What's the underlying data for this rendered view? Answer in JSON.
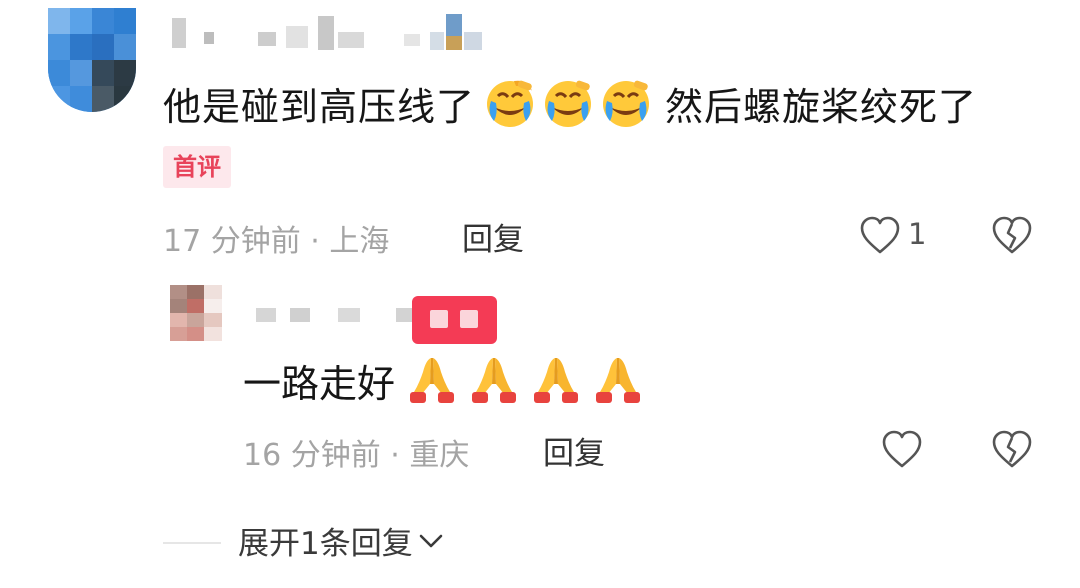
{
  "comment": {
    "text_before": "他是碰到高压线了",
    "emojis": [
      "crying-laugh-emoji",
      "crying-laugh-emoji",
      "crying-laugh-emoji"
    ],
    "text_after": "然后螺旋桨绞死了",
    "badge": "首评",
    "meta": "17 分钟前 · 上海",
    "reply_label": "回复",
    "like_count": "1"
  },
  "reply": {
    "text": "一路走好",
    "emojis": [
      "praying-hands-emoji",
      "praying-hands-emoji",
      "praying-hands-emoji",
      "praying-hands-emoji"
    ],
    "meta": "16 分钟前 · 重庆",
    "reply_label": "回复"
  },
  "expand": {
    "label": "展开1条回复"
  },
  "colors": {
    "badge_text": "#e8435a",
    "badge_bg": "#fde8ec",
    "author_badge": "#f43b55",
    "meta_text": "#a4a4a4"
  }
}
